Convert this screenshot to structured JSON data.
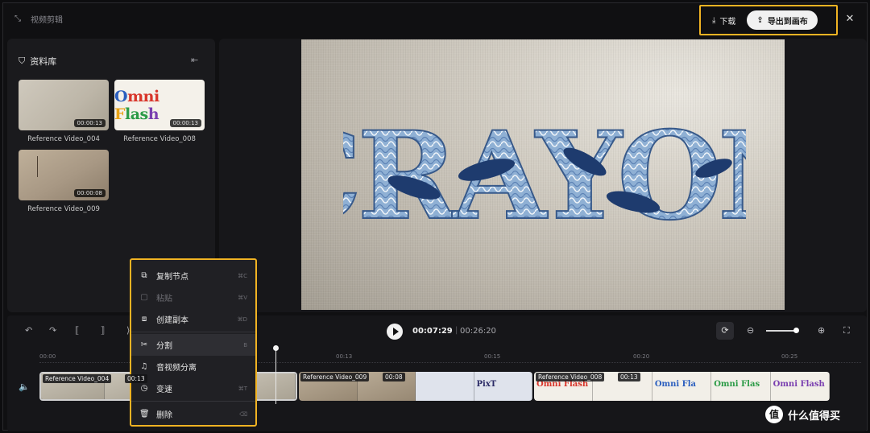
{
  "app": {
    "title": "视频剪辑"
  },
  "header": {
    "download_label": "下载",
    "export_label": "导出到画布"
  },
  "library": {
    "title": "资料库",
    "clips": [
      {
        "name": "Reference Video_004",
        "duration": "00:00:13"
      },
      {
        "name": "Reference Video_008",
        "duration": "00:00:13"
      },
      {
        "name": "Reference Video_009",
        "duration": "00:00:08"
      }
    ],
    "omni_text": [
      "O",
      "mni ",
      "F",
      "las",
      "h"
    ]
  },
  "preview": {
    "image_text": "CRAYON"
  },
  "player": {
    "current_time": "00:07:29",
    "total_time": "00:26:20"
  },
  "ruler": {
    "ticks": [
      "00:00",
      "00:13",
      "00:15",
      "00:20",
      "00:25"
    ]
  },
  "tracks": [
    {
      "label": "Reference Video_004",
      "duration": "00:13"
    },
    {
      "label": "Reference Video_009",
      "duration": "00:08"
    },
    {
      "label": "Reference Video_008",
      "duration": "00:13"
    }
  ],
  "track_texts": {
    "pix": "PixT",
    "omni1": "Omni Flash",
    "omni2": "Omni Fla",
    "omni3": "Omni Flas",
    "omni4": "Omni Flash"
  },
  "context_menu": {
    "items": [
      {
        "label": "复制节点",
        "shortcut": "⌘C",
        "disabled": false
      },
      {
        "label": "粘贴",
        "shortcut": "⌘V",
        "disabled": true
      },
      {
        "label": "创建副本",
        "shortcut": "⌘D",
        "disabled": false
      },
      {
        "label": "分割",
        "shortcut": "B",
        "disabled": false
      },
      {
        "label": "音视频分离",
        "shortcut": "",
        "disabled": false
      },
      {
        "label": "变速",
        "shortcut": "⌘T",
        "disabled": false
      },
      {
        "label": "删除",
        "shortcut": "⌫",
        "disabled": false
      }
    ]
  },
  "watermark": {
    "text": "什么值得买",
    "logo": "值"
  },
  "colors": {
    "highlight": "#f0b323",
    "background": "#101012",
    "panel": "#1a1a1d"
  }
}
